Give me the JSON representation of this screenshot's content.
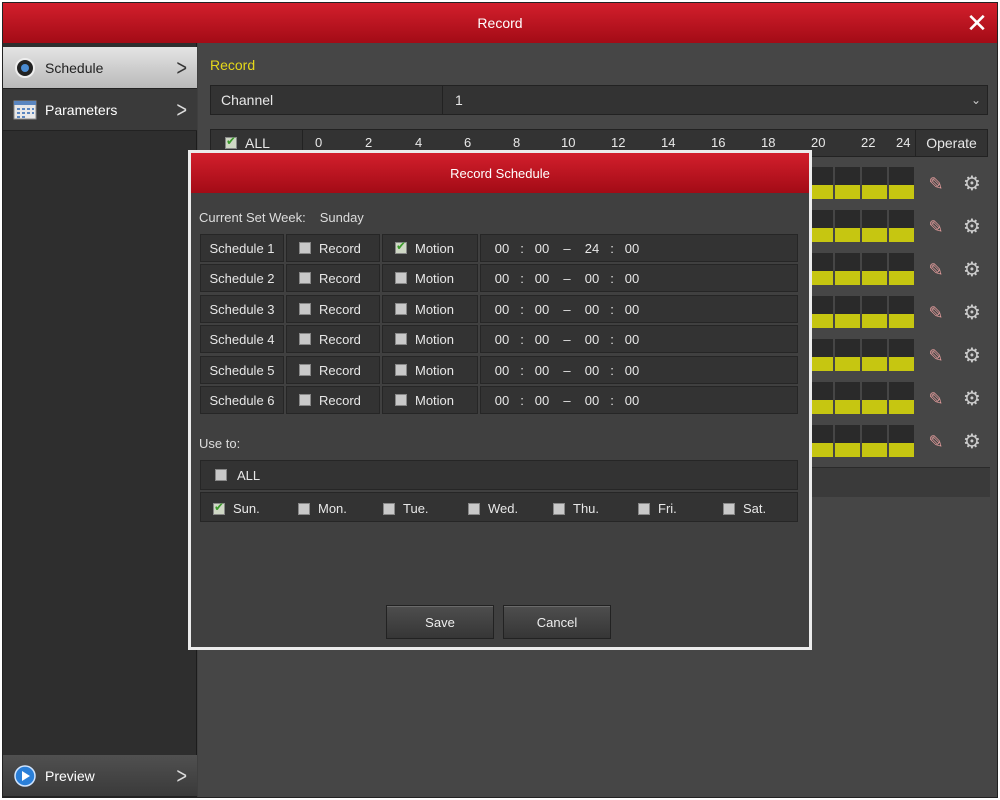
{
  "window": {
    "title": "Record",
    "close_glyph": "✕"
  },
  "sidebar": {
    "items": [
      {
        "label": "Schedule",
        "icon": "camera-icon",
        "active": true
      },
      {
        "label": "Parameters",
        "icon": "calendar-grid-icon",
        "active": false
      },
      {
        "label": "Preview",
        "icon": "play-icon",
        "active": false
      }
    ]
  },
  "content": {
    "section_title": "Record",
    "channel": {
      "label": "Channel",
      "value": "1"
    },
    "grid": {
      "all_label": "ALL",
      "all_checked": true,
      "hours": [
        "0",
        "2",
        "4",
        "6",
        "8",
        "10",
        "12",
        "14",
        "16",
        "18",
        "20",
        "22",
        "24"
      ],
      "operate_label": "Operate",
      "day_rows": 7
    }
  },
  "dialog": {
    "title": "Record Schedule",
    "current_week_label": "Current Set Week:",
    "current_week_value": "Sunday",
    "schedules": [
      {
        "name": "Schedule 1",
        "record_label": "Record",
        "record": false,
        "motion_label": "Motion",
        "motion": true,
        "start_h": "00",
        "start_m": "00",
        "end_h": "24",
        "end_m": "00"
      },
      {
        "name": "Schedule 2",
        "record_label": "Record",
        "record": false,
        "motion_label": "Motion",
        "motion": false,
        "start_h": "00",
        "start_m": "00",
        "end_h": "00",
        "end_m": "00"
      },
      {
        "name": "Schedule 3",
        "record_label": "Record",
        "record": false,
        "motion_label": "Motion",
        "motion": false,
        "start_h": "00",
        "start_m": "00",
        "end_h": "00",
        "end_m": "00"
      },
      {
        "name": "Schedule 4",
        "record_label": "Record",
        "record": false,
        "motion_label": "Motion",
        "motion": false,
        "start_h": "00",
        "start_m": "00",
        "end_h": "00",
        "end_m": "00"
      },
      {
        "name": "Schedule 5",
        "record_label": "Record",
        "record": false,
        "motion_label": "Motion",
        "motion": false,
        "start_h": "00",
        "start_m": "00",
        "end_h": "00",
        "end_m": "00"
      },
      {
        "name": "Schedule 6",
        "record_label": "Record",
        "record": false,
        "motion_label": "Motion",
        "motion": false,
        "start_h": "00",
        "start_m": "00",
        "end_h": "00",
        "end_m": "00"
      }
    ],
    "use_to_label": "Use to:",
    "all_label": "ALL",
    "all_checked": false,
    "days": [
      {
        "label": "Sun.",
        "checked": true
      },
      {
        "label": "Mon.",
        "checked": false
      },
      {
        "label": "Tue.",
        "checked": false
      },
      {
        "label": "Wed.",
        "checked": false
      },
      {
        "label": "Thu.",
        "checked": false
      },
      {
        "label": "Fri.",
        "checked": false
      },
      {
        "label": "Sat.",
        "checked": false
      }
    ],
    "save_label": "Save",
    "cancel_label": "Cancel"
  },
  "colors": {
    "title_red": "#c01320",
    "accent_yellow": "#e5d81a",
    "schedule_fill": "#c6c611"
  }
}
